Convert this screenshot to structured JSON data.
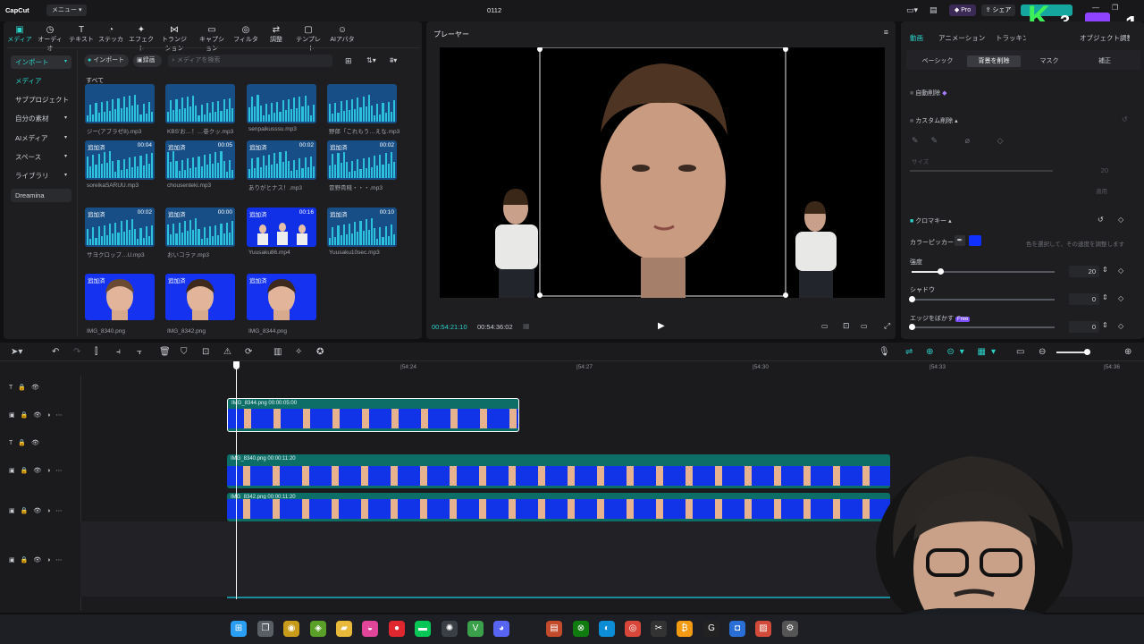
{
  "app": {
    "logo": "CapCut",
    "menu": "メニュー",
    "project": "0112"
  },
  "titlebar_right": {
    "pro": "Pro",
    "share": "シェア",
    "overlay_k": "K",
    "overlay_k_num": "3",
    "overlay_tw_num": "1"
  },
  "toolbar": [
    "メディア",
    "オーディオ",
    "テキスト",
    "ステッカー",
    "エフェクト",
    "トランジション",
    "キャプション",
    "フィルター",
    "調整",
    "テンプレート",
    "AIアバター"
  ],
  "sidebar": [
    {
      "label": "インポート",
      "chev": "▾"
    },
    {
      "label": "メディア",
      "chev": ""
    },
    {
      "label": "サブプロジェクト",
      "chev": ""
    },
    {
      "label": "自分の素材",
      "chev": "▾"
    },
    {
      "label": "AIメディア",
      "chev": "▾"
    },
    {
      "label": "スペース",
      "chev": "▾"
    },
    {
      "label": "ライブラリ",
      "chev": "▾"
    },
    {
      "label": "Dreamina",
      "chev": ""
    }
  ],
  "media_header": {
    "import_btn": "インポート",
    "record_btn": "録画",
    "search_placeholder": "メディアを検索",
    "all_label": "すべて"
  },
  "media_items": [
    {
      "name": "ジー(アプラゼ8).mp3",
      "badge": "",
      "dur": "",
      "kind": "audio"
    },
    {
      "name": "KBS'お…！…巻クッ.mp3",
      "badge": "",
      "dur": "",
      "kind": "audio"
    },
    {
      "name": "senpaikusssu.mp3",
      "badge": "",
      "dur": "",
      "kind": "audio"
    },
    {
      "name": "野郎「これもう…えな.mp3",
      "badge": "",
      "dur": "",
      "kind": "audio"
    },
    {
      "name": "soreikaSARUU.mp3",
      "badge": "追加済",
      "dur": "00:04",
      "kind": "audio"
    },
    {
      "name": "chousenteki.mp3",
      "badge": "追加済",
      "dur": "00:05",
      "kind": "audio"
    },
    {
      "name": "ありがとナス！.mp3",
      "badge": "追加済",
      "dur": "00:02",
      "kind": "audio"
    },
    {
      "name": "冒野貴賤・・・.mp3",
      "badge": "追加済",
      "dur": "00:02",
      "kind": "audio"
    },
    {
      "name": "サヨクロップ…U.mp3",
      "badge": "追加済",
      "dur": "00:02",
      "kind": "audio"
    },
    {
      "name": "おいコラァ.mp3",
      "badge": "追加済",
      "dur": "00:00",
      "kind": "audio"
    },
    {
      "name": "Yuusaku86.mp4",
      "badge": "追加済",
      "dur": "00:16",
      "kind": "video"
    },
    {
      "name": "Yuusaku10sec.mp3",
      "badge": "追加済",
      "dur": "00:10",
      "kind": "audio"
    },
    {
      "name": "IMG_8340.png",
      "badge": "追加済",
      "dur": "",
      "kind": "face1"
    },
    {
      "name": "IMG_8342.png",
      "badge": "追加済",
      "dur": "",
      "kind": "face2"
    },
    {
      "name": "IMG_8344.png",
      "badge": "追加済",
      "dur": "",
      "kind": "face3"
    }
  ],
  "player": {
    "title": "プレーヤー",
    "current_time": "00:54:21:10",
    "total_time": "00:54:36:02"
  },
  "props": {
    "tabs": [
      "動画",
      "アニメーション",
      "トラッキング",
      "オブジェクト調整"
    ],
    "subtabs": [
      "ベーシック",
      "背景を削除",
      "マスク",
      "補正"
    ],
    "auto_remove": "自動削除",
    "custom_remove": "カスタム削除",
    "size_label": "サイズ",
    "size_value": "20",
    "apply_label": "適用",
    "chroma_label": "クロマキー",
    "color_picker_label": "カラーピッカー",
    "color_hint": "色を選択して、その速度を調整します",
    "intensity_label": "強度",
    "intensity_value": "20",
    "shadow_label": "シャドウ",
    "shadow_value": "0",
    "edge_label": "エッジをぼかす",
    "edge_badge": "Free",
    "edge_value": "0",
    "chroma_color": "#1030ff",
    "intensity_level": 0.2,
    "shadow_level": 0.0,
    "edge_level": 0.0
  },
  "timeline": {
    "ticks": [
      "|54:24",
      "|54:27",
      "|54:30",
      "|54:33",
      "|54:36"
    ],
    "clips": [
      {
        "label": "IMG_8344.png  00:00:05:00"
      },
      {
        "label": "IMG_8340.png  00:00:11:20"
      },
      {
        "label": "IMG_8342.png  00:00:11:20"
      }
    ]
  },
  "taskbar_icons": [
    "windows-icon",
    "task-view-icon",
    "chrome-canary-icon",
    "nvidia-icon",
    "folder-icon",
    "lips-app-icon",
    "obs-icon",
    "line-icon",
    "chatgpt-icon",
    "vim-icon",
    "discord-icon",
    "app-icon",
    "xbox-icon",
    "edge-icon",
    "chrome-icon",
    "capcut-icon",
    "bitcoin-icon",
    "github-icon",
    "camera-app-icon",
    "photo-icon",
    "settings-icon"
  ]
}
